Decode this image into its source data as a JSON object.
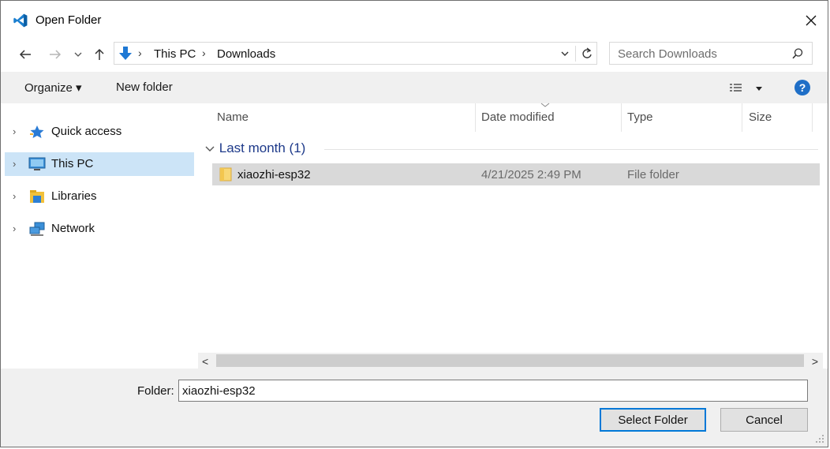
{
  "window": {
    "title": "Open Folder",
    "app_icon": "vscode-logo-icon",
    "close_icon": "close-icon"
  },
  "navigation": {
    "back_icon": "arrow-left-icon",
    "forward_icon": "arrow-right-icon",
    "recent_icon": "chevron-down-icon",
    "up_icon": "arrow-up-icon",
    "breadcrumb_icon": "downloads-arrow-icon",
    "breadcrumbs": [
      "This PC",
      "Downloads"
    ],
    "search_placeholder": "Search Downloads"
  },
  "commandbar": {
    "organize_label": "Organize ▾",
    "new_folder_label": "New folder",
    "view_icon": "view-options-icon",
    "help_label": "?"
  },
  "sidebar": {
    "items": [
      {
        "label": "Quick access",
        "icon": "star-icon",
        "selected": false
      },
      {
        "label": "This PC",
        "icon": "monitor-icon",
        "selected": true
      },
      {
        "label": "Libraries",
        "icon": "libraries-icon",
        "selected": false
      },
      {
        "label": "Network",
        "icon": "network-icon",
        "selected": false
      }
    ]
  },
  "filelist": {
    "columns": [
      "Name",
      "Date modified",
      "Type",
      "Size"
    ],
    "group": {
      "label": "Last month (1)"
    },
    "rows": [
      {
        "name": "xiaozhi-esp32",
        "date": "4/21/2025 2:49 PM",
        "type": "File folder",
        "size": ""
      }
    ]
  },
  "scrollbar": {
    "left": "<",
    "right": ">"
  },
  "footer": {
    "folder_label": "Folder:",
    "folder_value": "xiaozhi-esp32",
    "select_label": "Select Folder",
    "cancel_label": "Cancel"
  },
  "colors": {
    "accent": "#0078d7",
    "selection": "#cce4f7",
    "group_header": "#1e3a8a"
  }
}
